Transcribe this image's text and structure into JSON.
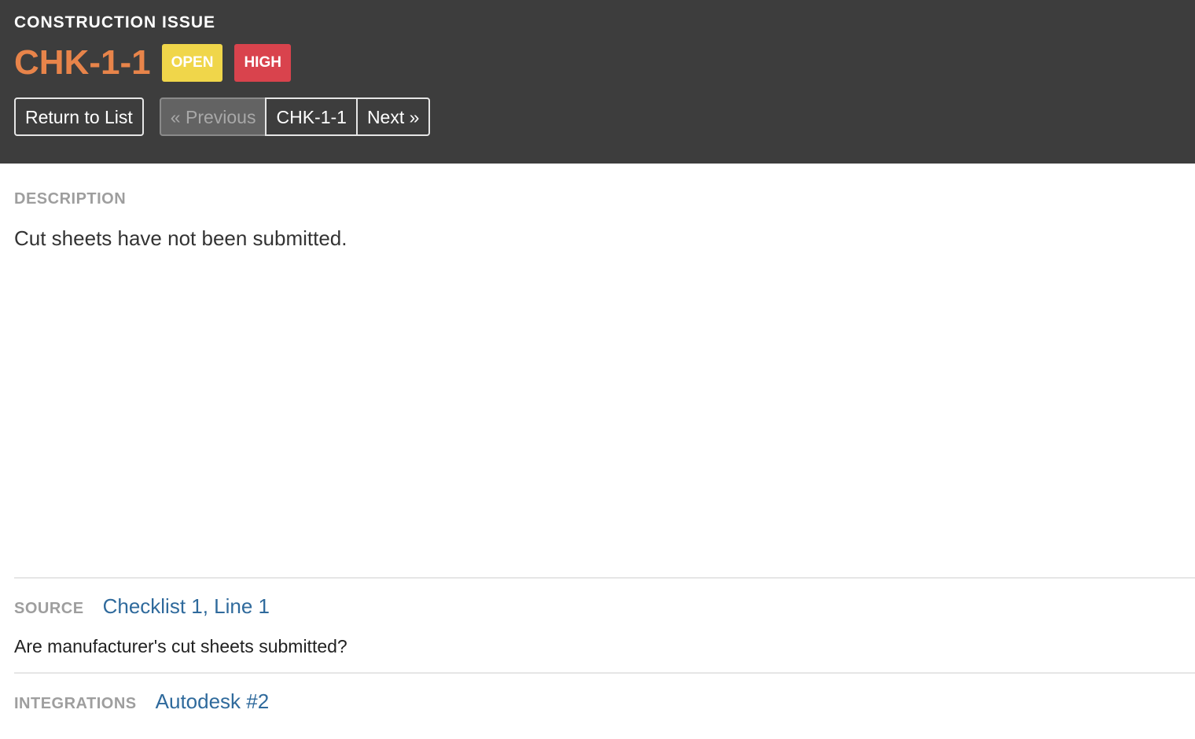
{
  "header": {
    "kicker": "CONSTRUCTION ISSUE",
    "issue_id": "CHK-1-1",
    "badges": {
      "status": "OPEN",
      "priority": "HIGH"
    },
    "colors": {
      "background": "#3d3d3d",
      "issue_id": "#e8844a",
      "status_badge": "#f0d64a",
      "priority_badge": "#d9434d"
    }
  },
  "nav": {
    "return_label": "Return to List",
    "previous_label": "« Previous",
    "current_label": "CHK-1-1",
    "next_label": "Next »",
    "previous_disabled": true
  },
  "description": {
    "label": "DESCRIPTION",
    "text": "Cut sheets have not been submitted."
  },
  "source": {
    "label": "SOURCE",
    "link_text": "Checklist 1, Line 1",
    "question": "Are manufacturer's cut sheets submitted?"
  },
  "integrations": {
    "label": "INTEGRATIONS",
    "link_text": "Autodesk #2"
  }
}
